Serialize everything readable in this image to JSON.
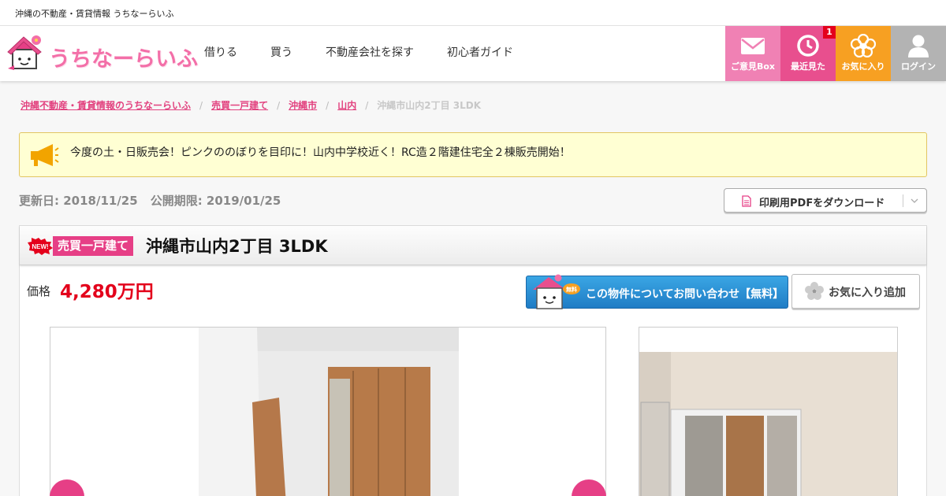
{
  "site": {
    "tagline": "沖縄の不動産・賃貸情報 うちなーらいふ",
    "logo_text": "うちなーらいふ"
  },
  "nav": {
    "items": [
      {
        "label": "借りる"
      },
      {
        "label": "買う"
      },
      {
        "label": "不動産会社を探す"
      },
      {
        "label": "初心者ガイド"
      }
    ]
  },
  "tools": {
    "box_label": "ご意見Box",
    "recent_label": "最近見た",
    "recent_count": "1",
    "fav_label": "お気に入り",
    "login_label": "ログイン"
  },
  "breadcrumb": {
    "items": [
      {
        "label": "沖縄不動産・賃貸情報のうちなーらいふ"
      },
      {
        "label": "売買一戸建て"
      },
      {
        "label": "沖縄市"
      },
      {
        "label": "山内"
      }
    ],
    "current": "沖縄市山内2丁目 3LDK"
  },
  "notice": {
    "text": "今度の土・日販売会！ピンクののぼりを目印に！山内中学校近く！RC造２階建住宅全２棟販売開始！"
  },
  "dates": {
    "updated": "更新日: 2018/11/25",
    "expires": "公開期限: 2019/01/25"
  },
  "pdf": {
    "label": "印刷用PDFをダウンロード"
  },
  "listing": {
    "category": "売買一戸建て",
    "title": "沖縄市山内2丁目 3LDK",
    "price_label": "価格",
    "price": "4,280万円",
    "inquiry_label": "この物件についてお問い合わせ【無料】",
    "fav_add_label": "お気に入り追加"
  },
  "colors": {
    "brand_pink": "#e63f86",
    "price_red": "#e3001b",
    "fav_orange": "#f7a022",
    "inquiry_blue": "#1f7cc5"
  }
}
